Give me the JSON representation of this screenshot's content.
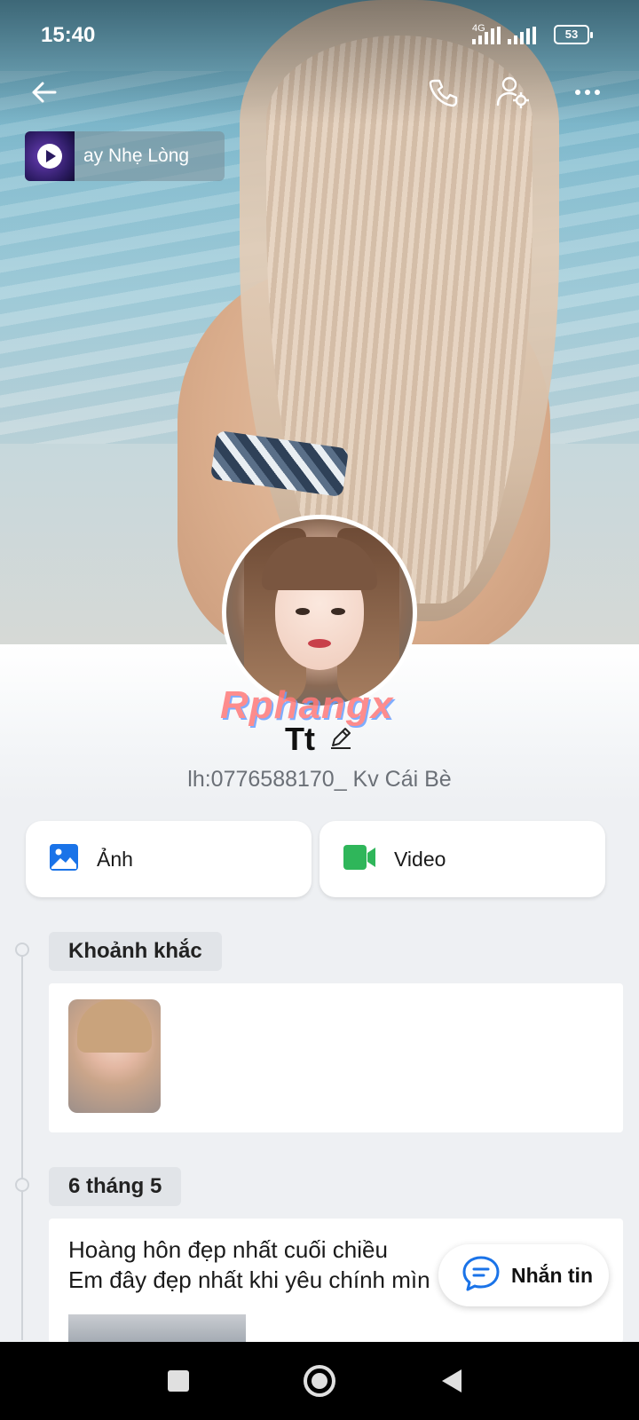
{
  "status_bar": {
    "time": "15:40",
    "network": "4G",
    "battery": "53"
  },
  "top_nav": {
    "back_icon": "arrow-left-icon",
    "call_icon": "phone-icon",
    "profile_settings_icon": "user-gear-icon",
    "more_icon": "more-horizontal-icon"
  },
  "music": {
    "title": "ay Nhẹ Lòng",
    "icon": "play-icon"
  },
  "profile": {
    "watermark": "Rphangx",
    "name": "Tt",
    "edit_icon": "pencil-icon",
    "bio": "lh:0776588170_ Kv Cái Bè"
  },
  "tiles": [
    {
      "label": "Ảnh",
      "icon": "image-icon",
      "color": "#1a73e8"
    },
    {
      "label": "Video",
      "icon": "video-camera-icon",
      "color": "#2fb65a"
    }
  ],
  "timeline": [
    {
      "label": "Khoảnh khắc"
    },
    {
      "label": "6 tháng 5",
      "text_lines": [
        "Hoàng hôn đẹp nhất cuối chiều",
        "Em đây đẹp nhất khi yêu chính mìn"
      ]
    }
  ],
  "message_button": {
    "label": "Nhắn tin",
    "icon": "chat-bubble-icon",
    "color": "#1a73e8"
  },
  "system_nav": {
    "recent_icon": "square-icon",
    "home_icon": "circle-icon",
    "back_icon": "triangle-back-icon"
  }
}
